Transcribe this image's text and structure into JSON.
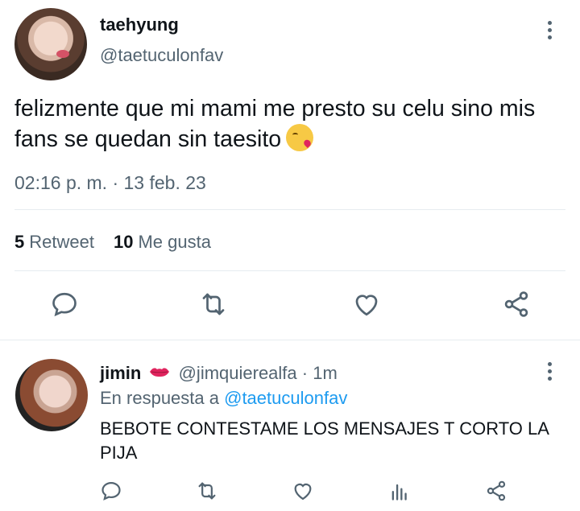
{
  "tweet": {
    "author_name": "taehyung",
    "author_handle": "@taetuculonfav",
    "text": "felizmente que mi mami me presto su celu sino mis fans se quedan sin taesito",
    "emoji": "kissing-face-emoji",
    "timestamp": "02:16 p. m. · 13 feb. 23",
    "retweets_count": "5",
    "retweets_label": "Retweet",
    "likes_count": "10",
    "likes_label": "Me gusta",
    "actions": [
      "reply-icon",
      "retweet-icon",
      "like-icon",
      "share-icon"
    ]
  },
  "reply": {
    "author_name": "jimin",
    "author_emoji": "lips-icon",
    "author_handle": "@jimquierealfa",
    "separator": "·",
    "time": "1m",
    "in_reply_prefix": "En respuesta a",
    "in_reply_mention": "@taetuculonfav",
    "text": "BEBOTE CONTESTAME LOS MENSAJES T CORTO LA PIJA",
    "actions": [
      "reply-icon",
      "retweet-icon",
      "like-icon",
      "analytics-icon",
      "share-icon"
    ]
  },
  "colors": {
    "text": "#0f1419",
    "secondary": "#536471",
    "accent": "#1d9bf0",
    "divider": "#e6ecf0",
    "lips": "#e0245e"
  }
}
